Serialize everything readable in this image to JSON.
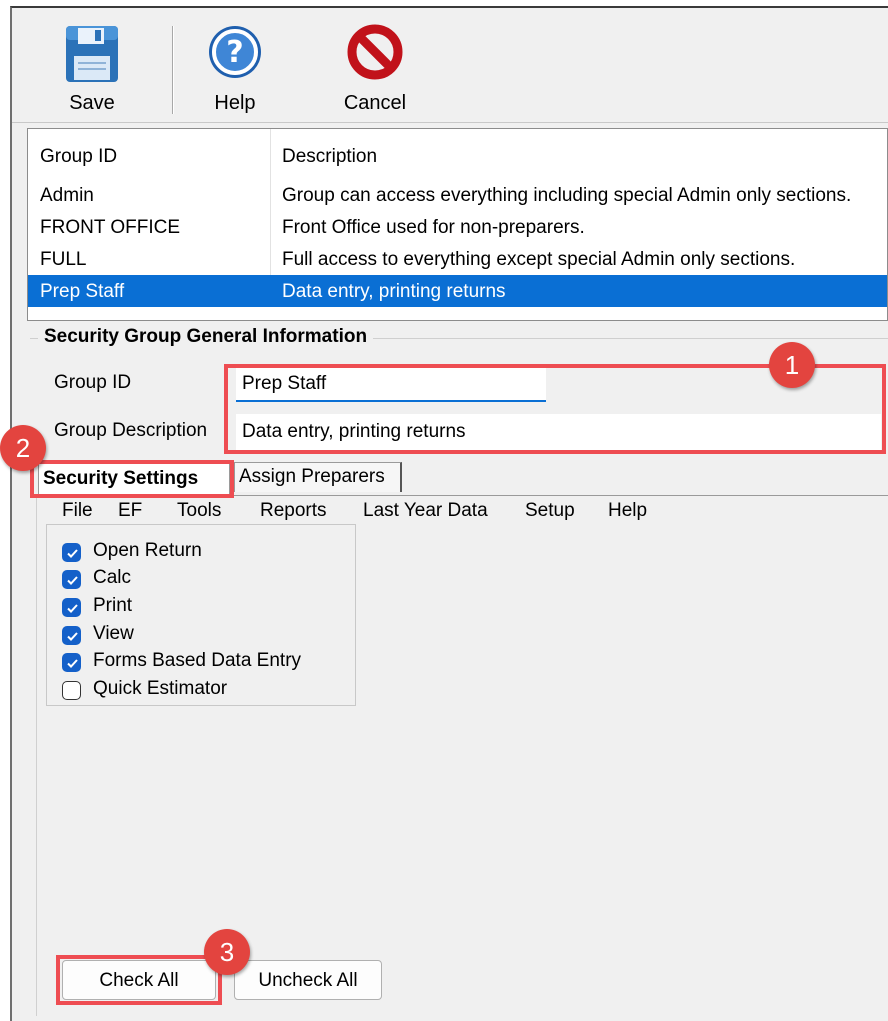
{
  "toolbar": {
    "save_label": "Save",
    "help_label": "Help",
    "cancel_label": "Cancel"
  },
  "groups_table": {
    "headers": [
      "Group ID",
      "Description"
    ],
    "rows": [
      {
        "id": "Admin",
        "description": "Group can access everything including special Admin only sections."
      },
      {
        "id": "FRONT OFFICE",
        "description": "Front Office used for non-preparers."
      },
      {
        "id": "FULL",
        "description": "Full access to everything except special Admin only sections."
      },
      {
        "id": "Prep Staff",
        "description": "Data entry, printing returns"
      }
    ],
    "selected_index": 3
  },
  "general_info": {
    "title": "Security Group General Information",
    "group_id_label": "Group ID",
    "group_id_value": "Prep Staff",
    "group_desc_label": "Group Description",
    "group_desc_value": "Data entry, printing returns"
  },
  "tabs": {
    "security_settings": "Security Settings",
    "assign_preparers": "Assign Preparers",
    "active": "Security Settings"
  },
  "menu": [
    "File",
    "EF",
    "Tools",
    "Reports",
    "Last Year Data",
    "Setup",
    "Help"
  ],
  "checks": [
    {
      "label": "Open Return",
      "checked": true
    },
    {
      "label": "Calc",
      "checked": true
    },
    {
      "label": "Print",
      "checked": true
    },
    {
      "label": "View",
      "checked": true
    },
    {
      "label": "Forms Based  Data Entry",
      "checked": true
    },
    {
      "label": "Quick Estimator",
      "checked": false
    }
  ],
  "buttons": {
    "check_all": "Check All",
    "uncheck_all": "Uncheck All"
  },
  "annotations": {
    "badge1": "1",
    "badge2": "2",
    "badge3": "3",
    "color": "#e3443f"
  },
  "colors": {
    "selection": "#0a6fd4",
    "checkbox": "#1460c9"
  }
}
